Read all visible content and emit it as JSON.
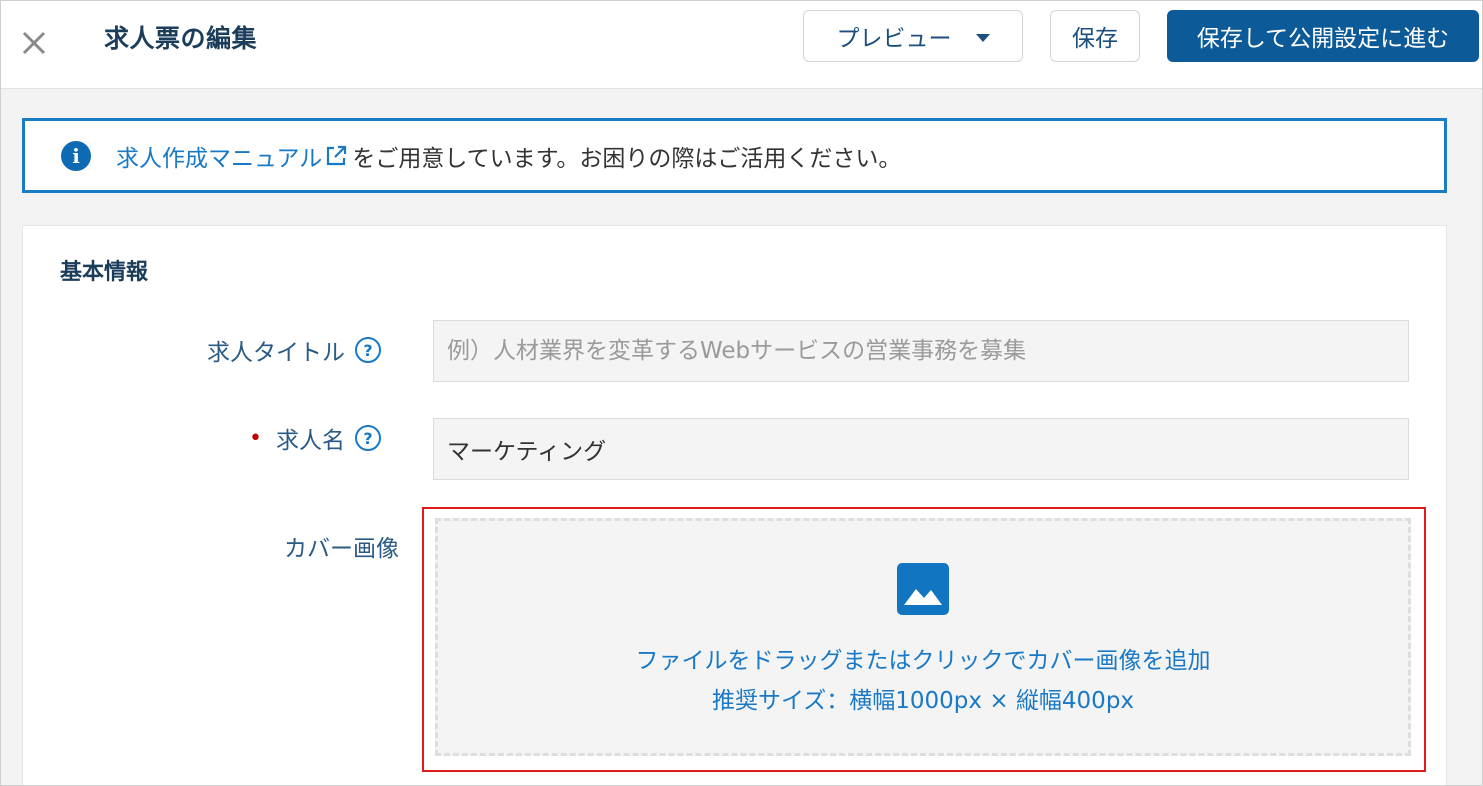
{
  "header": {
    "title": "求人票の編集",
    "preview_label": "プレビュー",
    "save_label": "保存",
    "publish_label": "保存して公開設定に進む"
  },
  "banner": {
    "link_text": "求人作成マニュアル",
    "rest_text": "をご用意しています。お困りの際はご活用ください。"
  },
  "form": {
    "section_title": "基本情報",
    "job_title": {
      "label": "求人タイトル",
      "placeholder": "例）人材業界を変革するWebサービスの営業事務を募集",
      "value": ""
    },
    "job_name": {
      "label": "求人名",
      "required_marker": "•",
      "value": "マーケティング"
    },
    "cover_image": {
      "label": "カバー画像",
      "drop_text": "ファイルをドラッグまたはクリックでカバー画像を追加",
      "size_hint": "推奨サイズ：横幅1000px × 縦幅400px"
    }
  },
  "colors": {
    "primary": "#0d5a99",
    "link": "#1a79c6",
    "highlight": "#e01b1b"
  }
}
